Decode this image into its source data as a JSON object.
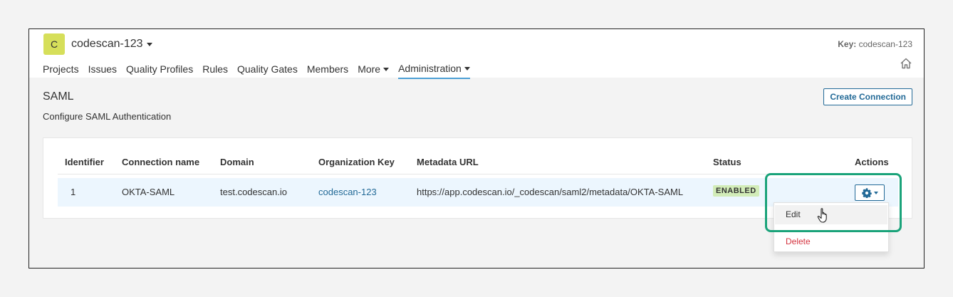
{
  "org": {
    "avatar_letter": "C",
    "name": "codescan-123"
  },
  "key": {
    "label": "Key:",
    "value": "codescan-123"
  },
  "nav": [
    {
      "label": "Projects"
    },
    {
      "label": "Issues"
    },
    {
      "label": "Quality Profiles"
    },
    {
      "label": "Rules"
    },
    {
      "label": "Quality Gates"
    },
    {
      "label": "Members"
    },
    {
      "label": "More"
    },
    {
      "label": "Administration"
    }
  ],
  "page": {
    "title": "SAML",
    "description": "Configure SAML Authentication",
    "create_button": "Create Connection"
  },
  "table": {
    "headers": [
      "Identifier",
      "Connection name",
      "Domain",
      "Organization Key",
      "Metadata URL",
      "Status",
      "Actions"
    ],
    "rows": [
      {
        "identifier": "1",
        "connection_name": "OKTA-SAML",
        "domain": "test.codescan.io",
        "org_key": "codescan-123",
        "metadata_url": "https://app.codescan.io/_codescan/saml2/metadata/OKTA-SAML",
        "status": "ENABLED"
      }
    ]
  },
  "actions_menu": {
    "edit": "Edit",
    "delete": "Delete"
  },
  "colors": {
    "accent": "#236a97",
    "avatar": "#d6df5a",
    "row_highlight": "#ecf6fe",
    "delete": "#d4333f",
    "callout": "#1aa37a"
  },
  "icons": {
    "home": "home-icon",
    "gear": "gear-icon",
    "cursor": "hand-pointer-icon"
  }
}
